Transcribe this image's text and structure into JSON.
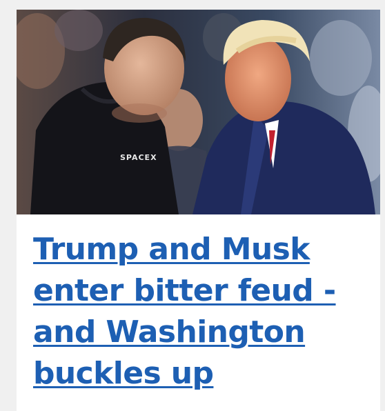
{
  "article": {
    "headline": "Trump and Musk enter bitter feud - and Washington buckles up",
    "image_shirt_logo": "SPACEX"
  },
  "colors": {
    "headline_link": "#1d5fb3",
    "card_background": "#ffffff",
    "page_background": "#f0f0f0"
  }
}
